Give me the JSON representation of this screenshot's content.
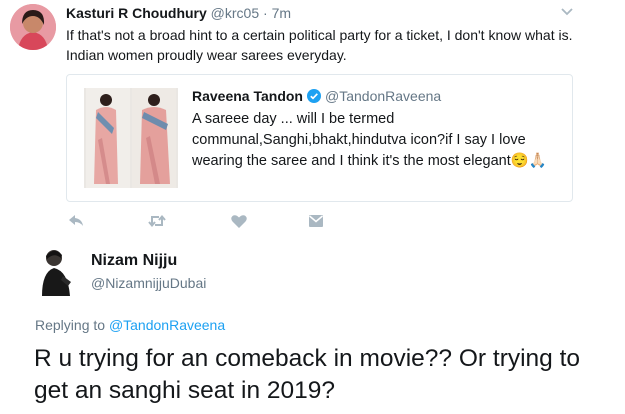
{
  "tweet": {
    "author_name": "Kasturi R Choudhury",
    "author_handle": "@krc05",
    "separator": "·",
    "time": "7m",
    "text": "If that's not a broad hint to a certain political party for a ticket, I don't know what is. Indian women proudly wear sarees everyday."
  },
  "quoted_tweet": {
    "author_name": "Raveena Tandon",
    "author_handle": "@TandonRaveena",
    "text": "A sareee day ... will I be termed communal,Sanghi,bhakt,hindutva icon?if I say I love wearing the saree and I think it's the most elegant😌🙏🏻"
  },
  "actions": {
    "icons": [
      "reply-icon",
      "retweet-icon",
      "like-icon",
      "message-icon"
    ]
  },
  "reply": {
    "author_name": "Nizam Nijju",
    "author_handle": "@NizamnijjuDubai",
    "replying_to_label": "Replying to",
    "replying_to_handle": "@TandonRaveena",
    "text": "R u trying for an comeback in movie?? Or trying to get an sanghi seat in 2019?"
  },
  "colors": {
    "link": "#1da1f2",
    "muted": "#657786",
    "text": "#14171a",
    "border": "#e1e8ed",
    "icon": "#aab8c2"
  }
}
